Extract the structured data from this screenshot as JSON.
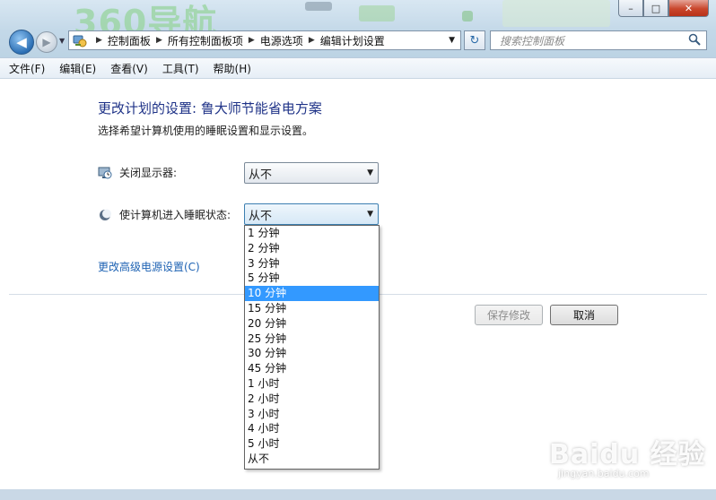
{
  "background": {
    "logo_text": "360导航"
  },
  "window_controls": {
    "minimize": "–",
    "maximize": "□",
    "close": "✕"
  },
  "nav": {
    "breadcrumb": [
      "控制面板",
      "所有控制面板项",
      "电源选项",
      "编辑计划设置"
    ],
    "search_placeholder": "搜索控制面板"
  },
  "menu": [
    "文件(F)",
    "编辑(E)",
    "查看(V)",
    "工具(T)",
    "帮助(H)"
  ],
  "page": {
    "title": "更改计划的设置: 鲁大师节能省电方案",
    "subtitle": "选择希望计算机使用的睡眠设置和显示设置。",
    "display_off_label": "关闭显示器:",
    "display_off_value": "从不",
    "sleep_label": "使计算机进入睡眠状态:",
    "sleep_value": "从不",
    "advanced_link": "更改高级电源设置(C)",
    "save_button": "保存修改",
    "cancel_button": "取消"
  },
  "dropdown": {
    "options": [
      "1 分钟",
      "2 分钟",
      "3 分钟",
      "5 分钟",
      "10 分钟",
      "15 分钟",
      "20 分钟",
      "25 分钟",
      "30 分钟",
      "45 分钟",
      "1 小时",
      "2 小时",
      "3 小时",
      "4 小时",
      "5 小时",
      "从不"
    ],
    "highlighted": "10 分钟"
  },
  "watermark": {
    "main": "Baidu 经验",
    "sub": "jingyan.baidu.com"
  },
  "colors": {
    "title_blue": "#1e3287",
    "link_blue": "#1d62b3",
    "highlight": "#3399ff",
    "close_red": "#c9462c"
  }
}
